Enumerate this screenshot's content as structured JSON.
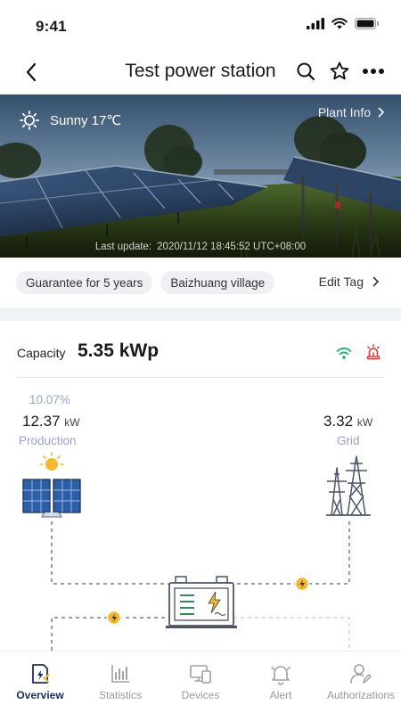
{
  "status_bar": {
    "time": "9:41"
  },
  "header": {
    "title": "Test power station"
  },
  "hero": {
    "weather": "Sunny 17℃",
    "plant_info": "Plant Info",
    "last_update_label": "Last update:",
    "last_update_value": "2020/11/12 18:45:52 UTC+08:00"
  },
  "tags": {
    "items": [
      "Guarantee for 5 years",
      "Baizhuang village"
    ],
    "edit_label": "Edit Tag"
  },
  "capacity": {
    "label": "Capacity",
    "value": "5.35 kWp"
  },
  "production": {
    "percent": "10.07%",
    "value": "12.37",
    "unit": "kW",
    "label": "Production"
  },
  "grid": {
    "value": "3.32",
    "unit": "kW",
    "label": "Grid"
  },
  "colors": {
    "accent": "#1c2d68",
    "wifi": "#1fb36b",
    "alarm": "#e5383b",
    "energy_dot": "#f5b82e",
    "muted_label": "#9aa3c7"
  },
  "tabs": [
    {
      "label": "Overview",
      "icon": "overview-icon",
      "active": true
    },
    {
      "label": "Statistics",
      "icon": "statistics-icon",
      "active": false
    },
    {
      "label": "Devices",
      "icon": "devices-icon",
      "active": false
    },
    {
      "label": "Alert",
      "icon": "alert-bell-icon",
      "active": false
    },
    {
      "label": "Authorizations",
      "icon": "authorizations-icon",
      "active": false
    }
  ]
}
